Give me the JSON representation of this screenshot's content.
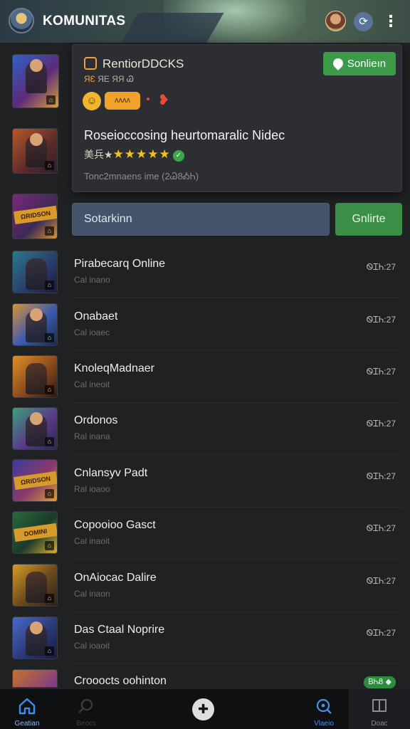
{
  "header": {
    "title": "KOMUNITAS",
    "logo_icon": "game-logo-icon",
    "avatar_icon": "user-avatar-icon",
    "share_icon": "share-icon",
    "menu_icon": "more-vertical-icon"
  },
  "card": {
    "title": "RentiorDDCKS",
    "subtitle_accent": "ЯƐ",
    "subtitle_rest": "ЯЕ ЯЯ Ꮚ",
    "pill_label": "ᴧᴧᴧᴧ",
    "follow_label": "Sonlieın",
    "headline": "Roseioccosing heurtomaralic Nidec",
    "rating_prefix": "美兵★",
    "stars": "★★★★★",
    "rating_badge": "✓",
    "meta": "Tonc2mnaens ime (2Ꮚ8ᎣᏂ)",
    "colors": {
      "accent": "#f0a23a",
      "follow": "#3b9b48"
    }
  },
  "search": {
    "value": "Sotarkinn",
    "online_label": "Gnlirte"
  },
  "list": [
    {
      "name": "Pirabecarq Online",
      "sub": "Cal inano",
      "time": "ᏫᏆᏂ:27"
    },
    {
      "name": "Onabaet",
      "sub": "Cal ioaec",
      "time": "ᏫᏆᏂ:27"
    },
    {
      "name": "KnoleqMadnaer",
      "sub": "Cal ineoit",
      "time": "ᏫᏆᏂ:27"
    },
    {
      "name": "Ordonos",
      "sub": "Ral inana",
      "time": "ᏫᏆᏂ:27"
    },
    {
      "name": "Cnlansyv Padt",
      "sub": "Ral ioaoo",
      "time": "ᏫᏆᏂ:27"
    },
    {
      "name": "Copooioo Gasct",
      "sub": "Cal inaoit",
      "time": "ᏫᏆᏂ:27"
    },
    {
      "name": "OnAiocac Dalire",
      "sub": "Cal inaon",
      "time": "ᏫᏆᏂ:27"
    },
    {
      "name": "Das Ctaal Noprire",
      "sub": "Cal ioaoit",
      "time": "ᏫᏆᏂ:27"
    },
    {
      "name": "Crooocts oohinton",
      "sub": "",
      "time": "",
      "badge": "ᏴᏂᏰ ◆"
    }
  ],
  "nav": {
    "home_label": "Geatian",
    "search_label": "Beocs",
    "center_icon": "center-action-icon",
    "explore_label": "Vlaeio",
    "docs_label": "Doac"
  }
}
